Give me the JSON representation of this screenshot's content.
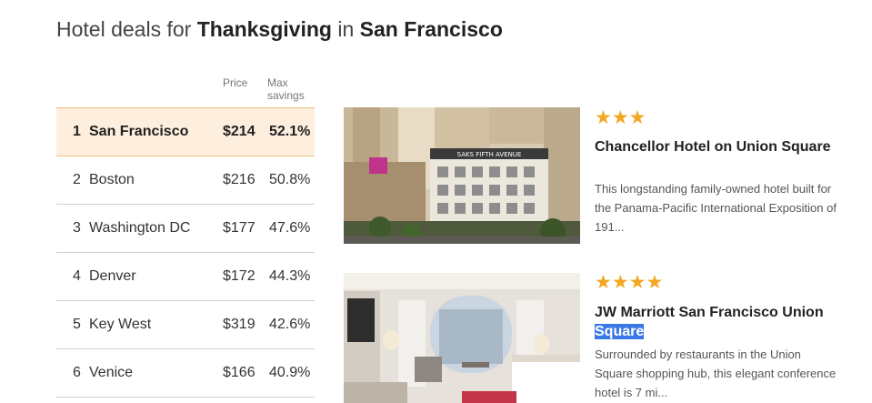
{
  "heading": {
    "prefix": "Hotel deals for ",
    "holiday": "Thanksgiving",
    "middle": " in ",
    "city": "San Francisco"
  },
  "table": {
    "price_header": "Price",
    "savings_header": "Max savings",
    "rows": [
      {
        "rank": "1",
        "city": "San Francisco",
        "price": "$214",
        "savings": "52.1%"
      },
      {
        "rank": "2",
        "city": "Boston",
        "price": "$216",
        "savings": "50.8%"
      },
      {
        "rank": "3",
        "city": "Washington DC",
        "price": "$177",
        "savings": "47.6%"
      },
      {
        "rank": "4",
        "city": "Denver",
        "price": "$172",
        "savings": "44.3%"
      },
      {
        "rank": "5",
        "city": "Key West",
        "price": "$319",
        "savings": "42.6%"
      },
      {
        "rank": "6",
        "city": "Venice",
        "price": "$166",
        "savings": "40.9%"
      }
    ]
  },
  "hotels": [
    {
      "stars": "★★★",
      "star_count": 3,
      "name": "Chancellor Hotel on Union Square",
      "description": "This longstanding family-owned hotel built for the Panama-Pacific International Exposition of 191...",
      "sign_text": "SAKS FIFTH AVENUE"
    },
    {
      "stars": "★★★★",
      "star_count": 4,
      "name_main": "JW Marriott San Francisco Union ",
      "name_selected": "Square",
      "description": "Surrounded by restaurants in the Union Square shopping hub, this elegant conference hotel is 7 mi..."
    }
  ],
  "colors": {
    "active_row_bg": "#fdeedd",
    "star_color": "#f5a623",
    "selection": "#3b78e7"
  }
}
